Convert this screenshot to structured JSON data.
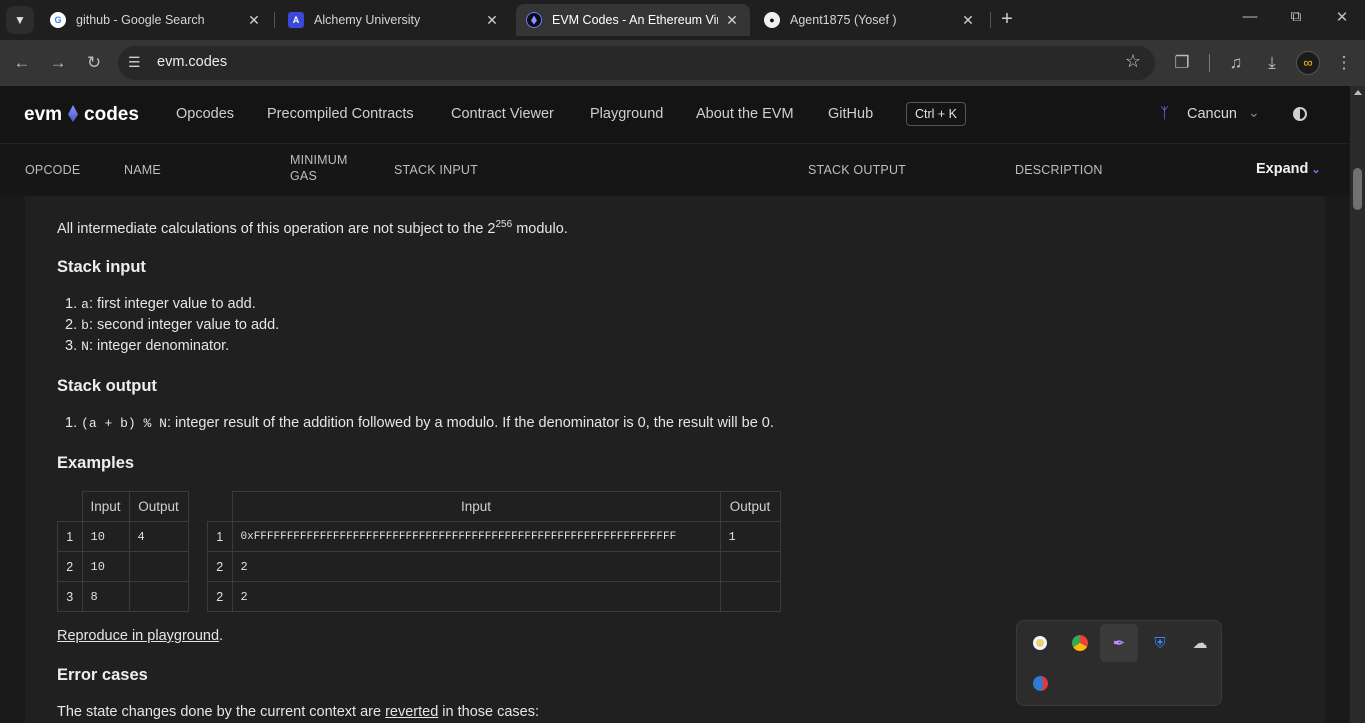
{
  "browser": {
    "tabs": [
      {
        "title": "github - Google Search",
        "icon": "google-icon",
        "active": false
      },
      {
        "title": "Alchemy University",
        "icon": "alchemy-icon",
        "active": false
      },
      {
        "title": "EVM Codes - An Ethereum Virtu",
        "icon": "ethereum-icon",
        "active": true
      },
      {
        "title": "Agent1875 (Yosef )",
        "icon": "github-icon",
        "active": false
      }
    ],
    "url": "evm.codes"
  },
  "site": {
    "logo_left": "evm",
    "logo_right": "codes",
    "nav": [
      "Opcodes",
      "Precompiled Contracts",
      "Contract Viewer",
      "Playground",
      "About the EVM",
      "GitHub"
    ],
    "shortcut": "Ctrl + K",
    "fork": "Cancun"
  },
  "table_header": {
    "opcode": "OPCODE",
    "name": "NAME",
    "min_gas_1": "MINIMUM",
    "min_gas_2": "GAS",
    "stack_input": "STACK INPUT",
    "stack_output": "STACK OUTPUT",
    "description": "DESCRIPTION",
    "expand": "Expand"
  },
  "content": {
    "intro_before": "All intermediate calculations of this operation are not subject to the 2",
    "intro_sup": "256",
    "intro_after": " modulo.",
    "stack_input_title": "Stack input",
    "stack_input_items": [
      {
        "num": "1.",
        "code": "a",
        "text": ": first integer value to add."
      },
      {
        "num": "2.",
        "code": "b",
        "text": ": second integer value to add."
      },
      {
        "num": "3.",
        "code": "N",
        "text": ": integer denominator."
      }
    ],
    "stack_output_title": "Stack output",
    "stack_output_items": [
      {
        "num": "1.",
        "code": "(a + b) % N",
        "text": ": integer result of the addition followed by a modulo. If the denominator is 0, the result will be 0."
      }
    ],
    "examples_title": "Examples",
    "example1": {
      "headers": [
        "Input",
        "Output"
      ],
      "rows": [
        {
          "idx": "1",
          "input": "10",
          "output": "4"
        },
        {
          "idx": "2",
          "input": "10",
          "output": ""
        },
        {
          "idx": "3",
          "input": "8",
          "output": ""
        }
      ]
    },
    "example2": {
      "headers": [
        "Input",
        "Output"
      ],
      "rows": [
        {
          "idx": "1",
          "input": "0xFFFFFFFFFFFFFFFFFFFFFFFFFFFFFFFFFFFFFFFFFFFFFFFFFFFFFFFFFFFFFFFF",
          "output": "1"
        },
        {
          "idx": "2",
          "input": "2",
          "output": ""
        },
        {
          "idx": "2",
          "input": "2",
          "output": ""
        }
      ]
    },
    "reproduce_link": "Reproduce in playground",
    "reproduce_tail": ".",
    "error_title": "Error cases",
    "error_before": "The state changes done by the current context are ",
    "error_link": "reverted",
    "error_after": " in those cases:"
  },
  "tray": {
    "icons": [
      "disc-app-icon",
      "chrome-icon",
      "feather-app-icon",
      "security-warning-icon",
      "cloud-offline-icon",
      "notification-app-icon"
    ]
  }
}
